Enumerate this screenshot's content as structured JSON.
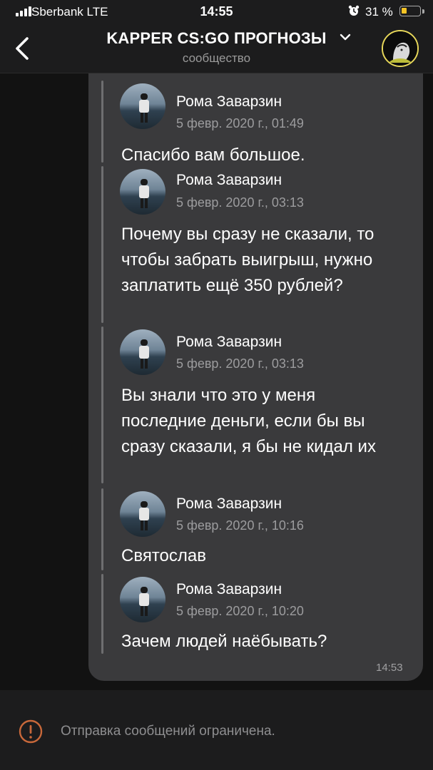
{
  "status_bar": {
    "carrier": "Sberbank  LTE",
    "time": "14:55",
    "battery_percent": "31 %",
    "battery_level": 0.31,
    "icons": [
      "signal-icon",
      "alarm-icon",
      "battery-icon"
    ]
  },
  "header": {
    "title": "KAPPER CS:GO ПРОГНОЗЫ",
    "subtitle": "сообщество"
  },
  "message": {
    "time": "14:53",
    "forwarded": [
      {
        "author": "Рома Заварзин",
        "date": "5 февр. 2020 г., 01:49",
        "text": "Спасибо вам большое."
      },
      {
        "author": "Рома Заварзин",
        "date": "5 февр. 2020 г., 03:13",
        "text": "Почему вы сразу не сказали, то чтобы забрать выигрыш, нужно заплатить ещё 350 рублей?"
      },
      {
        "author": "Рома Заварзин",
        "date": "5 февр. 2020 г., 03:13",
        "text": "Вы знали что это у меня последние деньги, если бы вы сразу сказали, я бы не кидал их"
      },
      {
        "author": "Рома Заварзин",
        "date": "5 февр. 2020 г., 10:16",
        "text": "Святослав"
      },
      {
        "author": "Рома Заварзин",
        "date": "5 февр. 2020 г., 10:20",
        "text": "Зачем людей наёбывать?"
      }
    ]
  },
  "footer": {
    "notice": "Отправка сообщений ограничена.",
    "icon": "warning-icon"
  },
  "colors": {
    "background": "#121212",
    "bars": "#1c1c1d",
    "bubble": "#3a3a3c",
    "secondary_text": "#9c9c9e",
    "battery_fill": "#f4c425",
    "warning": "#c8683a"
  }
}
